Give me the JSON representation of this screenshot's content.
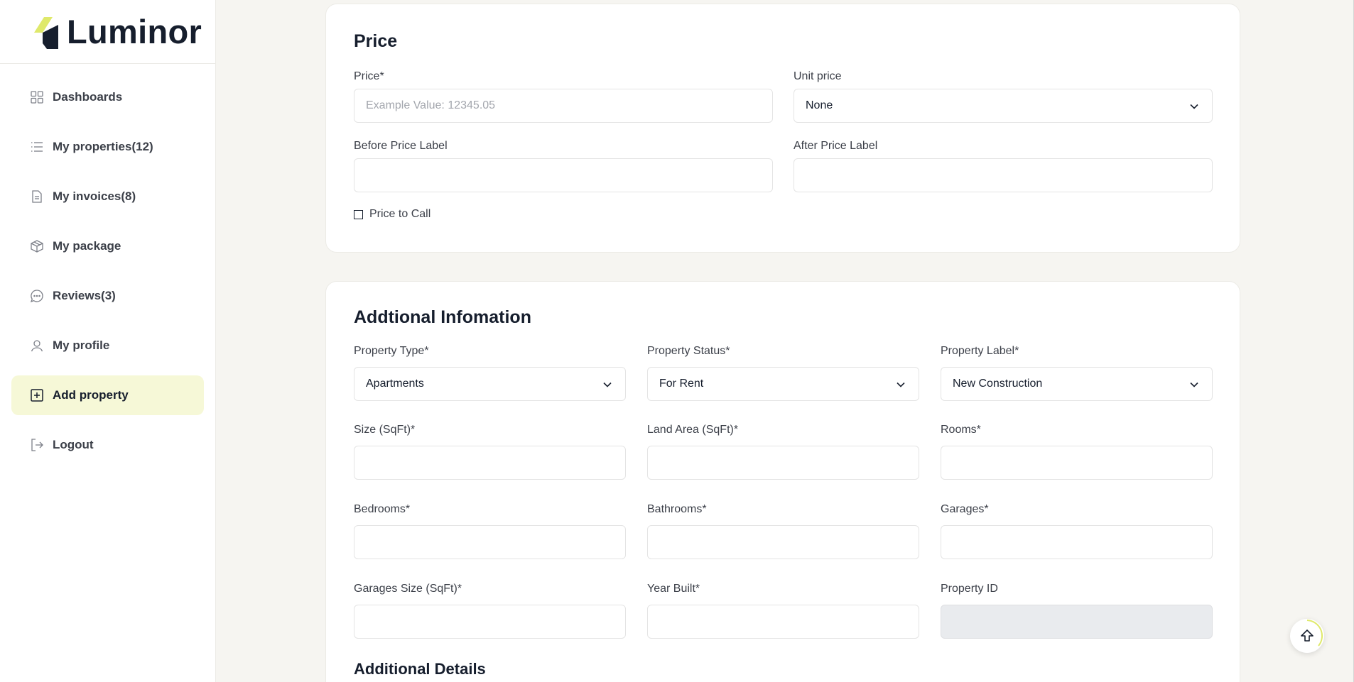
{
  "brand": {
    "name": "Luminor",
    "accent": "#dfe96b",
    "dark": "#161e2d"
  },
  "sidebar": {
    "items": [
      {
        "label": "Dashboards",
        "icon": "grid-icon"
      },
      {
        "label": "My properties(12)",
        "icon": "list-icon"
      },
      {
        "label": "My invoices(8)",
        "icon": "file-icon"
      },
      {
        "label": "My package",
        "icon": "package-icon"
      },
      {
        "label": "Reviews(3)",
        "icon": "chat-icon"
      },
      {
        "label": "My profile",
        "icon": "user-icon"
      },
      {
        "label": "Add property",
        "icon": "plus-square-icon",
        "active": true
      },
      {
        "label": "Logout",
        "icon": "logout-icon"
      }
    ]
  },
  "price": {
    "title": "Price",
    "price_label": "Price*",
    "price_placeholder": "Example Value: 12345.05",
    "unit_price_label": "Unit price",
    "unit_price_value": "None",
    "before_label": "Before Price Label",
    "after_label": "After Price Label",
    "price_to_call": "Price to Call"
  },
  "additional": {
    "title": "Addtional Infomation",
    "property_type_label": "Property Type*",
    "property_type_value": "Apartments",
    "property_status_label": "Property Status*",
    "property_status_value": "For Rent",
    "property_label_label": "Property Label*",
    "property_label_value": "New Construction",
    "size_label": "Size (SqFt)*",
    "land_area_label": "Land Area (SqFt)*",
    "rooms_label": "Rooms*",
    "bedrooms_label": "Bedrooms*",
    "bathrooms_label": "Bathrooms*",
    "garages_label": "Garages*",
    "garages_size_label": "Garages Size (SqFt)*",
    "year_built_label": "Year Built*",
    "property_id_label": "Property ID",
    "details_title": "Additional Details"
  }
}
